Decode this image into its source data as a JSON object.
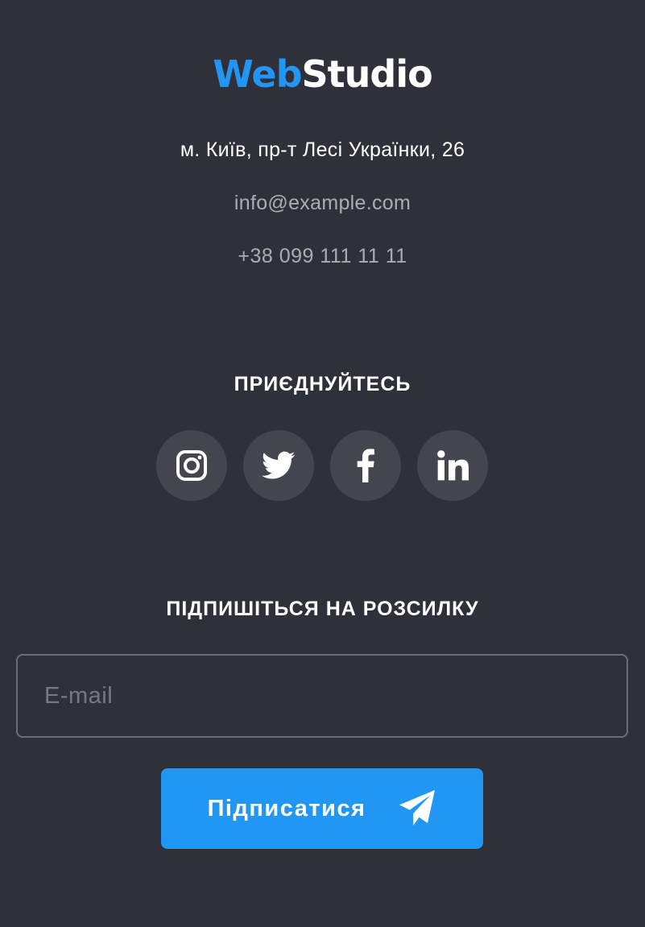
{
  "logo": {
    "part1": "Web",
    "part2": "Studio"
  },
  "contacts": {
    "address": "м. Київ, пр-т Лесі Українки, 26",
    "email": "info@example.com",
    "phone": "+38 099 111 11 11"
  },
  "join": {
    "title": "ПРИЄДНУЙТЕСЬ",
    "socials": [
      {
        "icon": "instagram-icon"
      },
      {
        "icon": "twitter-icon"
      },
      {
        "icon": "facebook-icon"
      },
      {
        "icon": "linkedin-icon"
      }
    ]
  },
  "subscribe": {
    "title": "ПІДПИШІТЬСЯ НА РОЗСИЛКУ",
    "email_placeholder": "E-mail",
    "email_value": "",
    "button_label": "Підписатися",
    "button_icon": "paper-plane-icon"
  },
  "colors": {
    "background": "#2f303a",
    "accent": "#2196f3",
    "text": "#ffffff"
  }
}
